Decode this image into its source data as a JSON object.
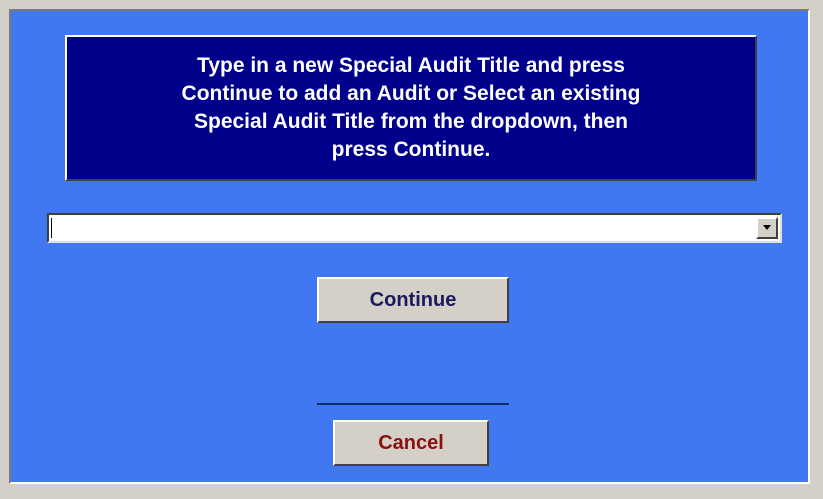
{
  "dialog": {
    "instructions": "Type in a new Special Audit Title and press\nContinue to add an Audit or Select an existing\nSpecial Audit Title from the dropdown, then\npress Continue.",
    "combo": {
      "value": "",
      "arrow_icon": "dropdown-arrow-icon"
    },
    "continue_label": "Continue",
    "cancel_label": "Cancel",
    "colors": {
      "background": "#3f78f0",
      "instruction_panel": "#00008a",
      "continue_text": "#1a1a5e",
      "cancel_text": "#8b1010"
    }
  }
}
